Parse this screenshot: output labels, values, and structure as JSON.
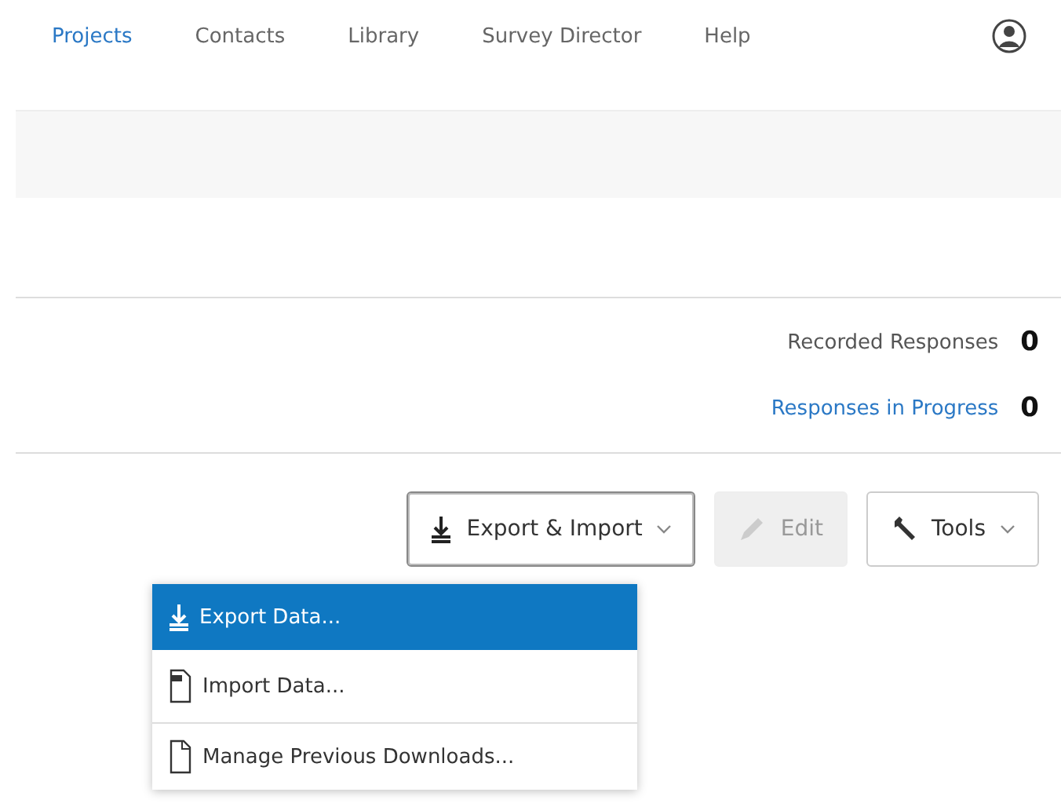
{
  "nav": [
    {
      "label": "Projects",
      "selected": true
    },
    {
      "label": "Contacts",
      "selected": false
    },
    {
      "label": "Library",
      "selected": false
    },
    {
      "label": "Survey Director",
      "selected": false
    },
    {
      "label": "Help",
      "selected": false
    }
  ],
  "stats": [
    {
      "kind": "plain",
      "label": "Recorded Responses",
      "value": "0"
    },
    {
      "kind": "link",
      "label": "Responses in Progress",
      "value": "0"
    }
  ],
  "toolbar": [
    {
      "kind": "export",
      "label": "Export & Import",
      "disabled": false,
      "open": true
    },
    {
      "kind": "edit",
      "label": "Edit",
      "disabled": true
    },
    {
      "kind": "tools",
      "label": "Tools",
      "disabled": false
    }
  ],
  "menu": [
    {
      "kind": "export",
      "label": "Export Data...",
      "selected": true,
      "divider_after": false
    },
    {
      "kind": "import",
      "label": "Import Data...",
      "selected": false,
      "divider_after": true
    },
    {
      "kind": "manage",
      "label": "Manage Previous Downloads...",
      "selected": false,
      "divider_after": false
    }
  ]
}
